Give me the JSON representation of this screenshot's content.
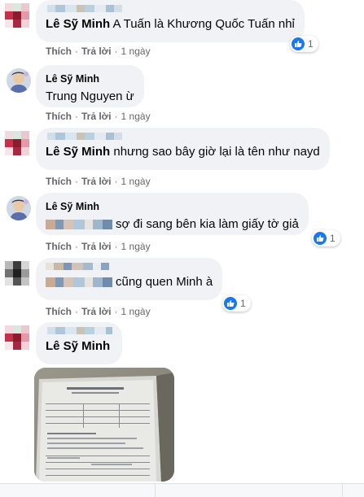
{
  "actions": {
    "like": "Thích",
    "reply": "Trả lời",
    "separator": "·"
  },
  "comments": [
    {
      "author": "Lê Sỹ Minh",
      "text": "A Tuấn là Khương Quốc Tuấn nhỉ",
      "time": "1 ngày",
      "reactions": "1"
    },
    {
      "author": "Lê Sỹ Minh",
      "text": "Trung Nguyen ừ",
      "time": "1 ngày",
      "reactions": ""
    },
    {
      "author": "Lê Sỹ Minh",
      "text": "nhưng sao bây giờ lại là tên như nayd",
      "time": "1 ngày",
      "reactions": ""
    },
    {
      "author": "Lê Sỹ Minh",
      "text": "sợ đi sang bên kia làm giấy tờ giả",
      "time": "1 ngày",
      "reactions": "1"
    },
    {
      "author": "",
      "text": "cũng quen Minh à",
      "time": "1 ngày",
      "reactions": "1"
    },
    {
      "author": "Lê Sỹ Minh",
      "text": "",
      "time": "",
      "reactions": ""
    }
  ],
  "colors": {
    "bubble": "#f0f2f5",
    "meta": "#65676b",
    "like_blue": "#1877f2"
  },
  "icons": [
    "like-icon",
    "avatar",
    "attached-photo"
  ]
}
